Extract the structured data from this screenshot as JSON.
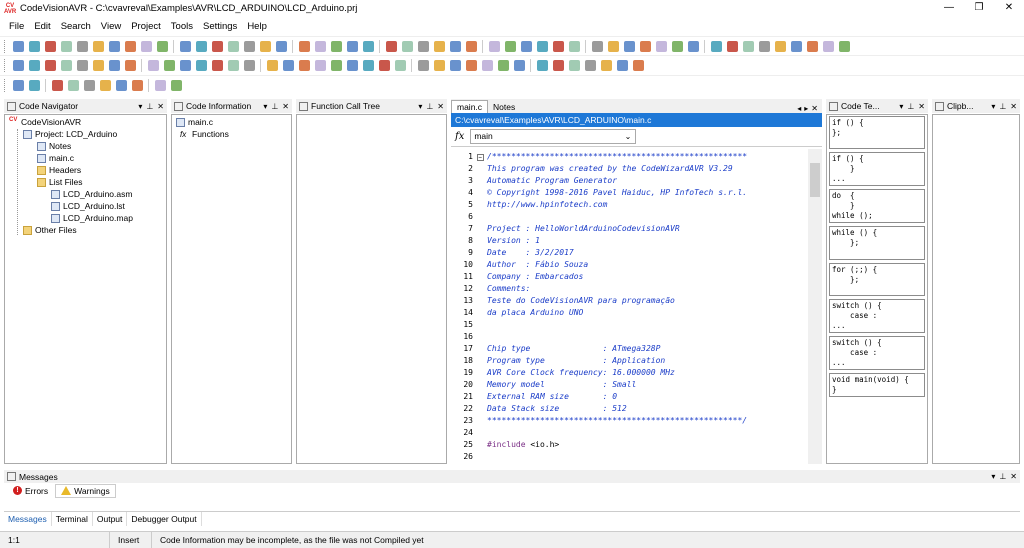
{
  "window": {
    "title": "CodeVisionAVR - C:\\cvavreval\\Examples\\AVR\\LCD_ARDUINO\\LCD_Arduino.prj",
    "logo_text": "CV AVR",
    "minimize": "—",
    "restore": "❐",
    "close": "✕"
  },
  "menu": [
    "File",
    "Edit",
    "Search",
    "View",
    "Project",
    "Tools",
    "Settings",
    "Help"
  ],
  "panels": {
    "code_navigator": {
      "title": "Code Navigator"
    },
    "code_information": {
      "title": "Code Information"
    },
    "function_call_tree": {
      "title": "Function Call Tree"
    },
    "code_templates": {
      "title": "Code Te..."
    },
    "clipboard_history": {
      "title": "Clipb..."
    }
  },
  "panel_buttons": {
    "dropdown": "▾",
    "pin": "⊥",
    "close": "✕"
  },
  "navigator_tree": [
    {
      "label": "CodeVisionAVR",
      "icon": "cv-logo-icon"
    },
    {
      "label": "Project: LCD_Arduino",
      "icon": "project-icon"
    },
    {
      "label": "Notes",
      "icon": "notes-icon"
    },
    {
      "label": "main.c",
      "icon": "c-file-icon"
    },
    {
      "label": "Headers",
      "icon": "folder-icon"
    },
    {
      "label": "List Files",
      "icon": "folder-icon"
    },
    {
      "label": "LCD_Arduino.asm",
      "icon": "file-icon"
    },
    {
      "label": "LCD_Arduino.lst",
      "icon": "file-icon"
    },
    {
      "label": "LCD_Arduino.map",
      "icon": "file-icon"
    },
    {
      "label": "Other Files",
      "icon": "folder-icon"
    }
  ],
  "info_tree": [
    {
      "label": "main.c",
      "icon": "c-file-icon"
    },
    {
      "label": "Functions",
      "icon": "function-icon"
    }
  ],
  "editor": {
    "tabs": [
      {
        "label": "main.c",
        "active": true
      },
      {
        "label": "Notes",
        "active": false
      }
    ],
    "path": "C:\\cvavreval\\Examples\\AVR\\LCD_ARDUINO\\main.c",
    "function_selected": "main",
    "fx_label": "fx",
    "code": [
      {
        "n": "1",
        "t": "/*****************************************************"
      },
      {
        "n": "2",
        "t": "This program was created by the CodeWizardAVR V3.29"
      },
      {
        "n": "3",
        "t": "Automatic Program Generator"
      },
      {
        "n": "4",
        "t": "© Copyright 1998-2016 Pavel Haiduc, HP InfoTech s.r.l."
      },
      {
        "n": "5",
        "t": "http://www.hpinfotech.com"
      },
      {
        "n": "6",
        "t": ""
      },
      {
        "n": "7",
        "t": "Project : HelloWorldArduinoCodevisionAVR"
      },
      {
        "n": "8",
        "t": "Version : 1"
      },
      {
        "n": "9",
        "t": "Date    : 3/2/2017"
      },
      {
        "n": "10",
        "t": "Author  : Fábio Souza"
      },
      {
        "n": "11",
        "t": "Company : Embarcados"
      },
      {
        "n": "12",
        "t": "Comments:"
      },
      {
        "n": "13",
        "t": "Teste do CodeVisionAVR para programação"
      },
      {
        "n": "14",
        "t": "da placa Arduino UNO"
      },
      {
        "n": "15",
        "t": ""
      },
      {
        "n": "16",
        "t": ""
      },
      {
        "n": "17",
        "t": "Chip type               : ATmega328P"
      },
      {
        "n": "18",
        "t": "Program type            : Application"
      },
      {
        "n": "19",
        "t": "AVR Core Clock frequency: 16.000000 MHz"
      },
      {
        "n": "20",
        "t": "Memory model            : Small"
      },
      {
        "n": "21",
        "t": "External RAM size       : 0"
      },
      {
        "n": "22",
        "t": "Data Stack size         : 512"
      },
      {
        "n": "23",
        "t": "*****************************************************/"
      },
      {
        "n": "24",
        "t": ""
      },
      {
        "n": "25",
        "t": "#include <io.h>",
        "kind": "include"
      },
      {
        "n": "26",
        "t": ""
      }
    ]
  },
  "code_templates": [
    "if () {\n};",
    "if () {\n    }\n...",
    "do  {\n    }\nwhile ();",
    "while () {\n    };",
    "for (;;) {\n    };",
    "switch () {\n    case :\n...",
    "switch () {\n    case :\n...",
    "void main(void) {\n}"
  ],
  "messages": {
    "title": "Messages",
    "tabs": [
      {
        "label": "Errors",
        "icon": "error-icon"
      },
      {
        "label": "Warnings",
        "icon": "warning-icon"
      }
    ],
    "bottom_tabs": [
      "Messages",
      "Terminal",
      "Output",
      "Debugger Output"
    ]
  },
  "statusbar": {
    "position": "1:1",
    "mode": "Insert",
    "message": "Code Information may be incomplete, as the file was not Compiled yet"
  },
  "colors": {
    "accent_blue": "#1e78d7",
    "comment_blue": "#1a3cc8",
    "logo_red": "#d22222"
  }
}
